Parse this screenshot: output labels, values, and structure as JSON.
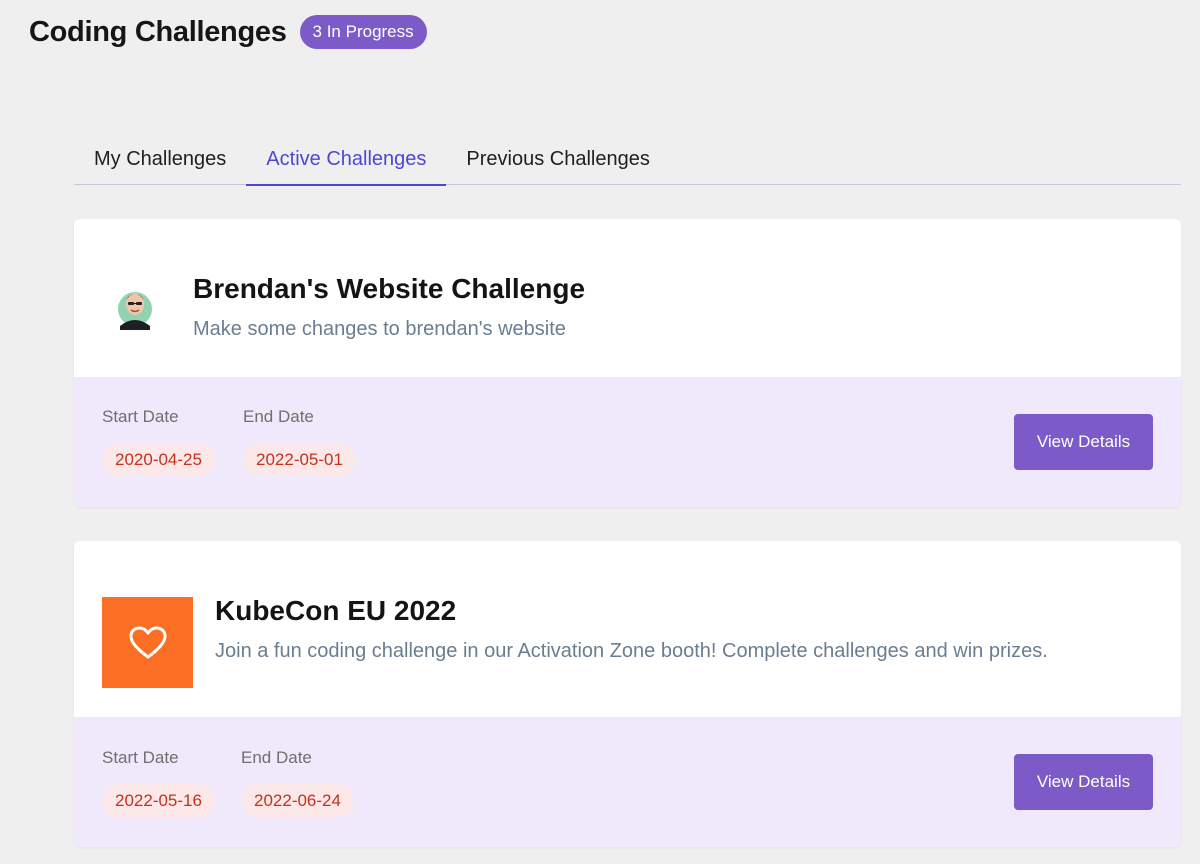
{
  "header": {
    "title": "Coding Challenges",
    "badge": "3 In Progress"
  },
  "tabs": [
    {
      "label": "My Challenges",
      "active": false
    },
    {
      "label": "Active Challenges",
      "active": true
    },
    {
      "label": "Previous Challenges",
      "active": false
    }
  ],
  "challenges": [
    {
      "icon": "person-avatar-icon",
      "title": "Brendan's Website Challenge",
      "description": "Make some changes to brendan's website",
      "start_label": "Start Date",
      "start_date": "2020-04-25",
      "end_label": "End Date",
      "end_date": "2022-05-01",
      "button": "View Details"
    },
    {
      "icon": "heart-icon",
      "title": "KubeCon EU 2022",
      "description": "Join a fun coding challenge in our Activation Zone booth! Complete challenges and win prizes.",
      "start_label": "Start Date",
      "start_date": "2022-05-16",
      "end_label": "End Date",
      "end_date": "2022-06-24",
      "button": "View Details"
    }
  ],
  "colors": {
    "accent": "#7c5bc9",
    "active_tab": "#4f46d6",
    "card_footer": "#efe9fb",
    "date_chip_bg": "#fce8e8",
    "date_chip_text": "#c4321c",
    "heart_tile": "#fb6f24"
  }
}
